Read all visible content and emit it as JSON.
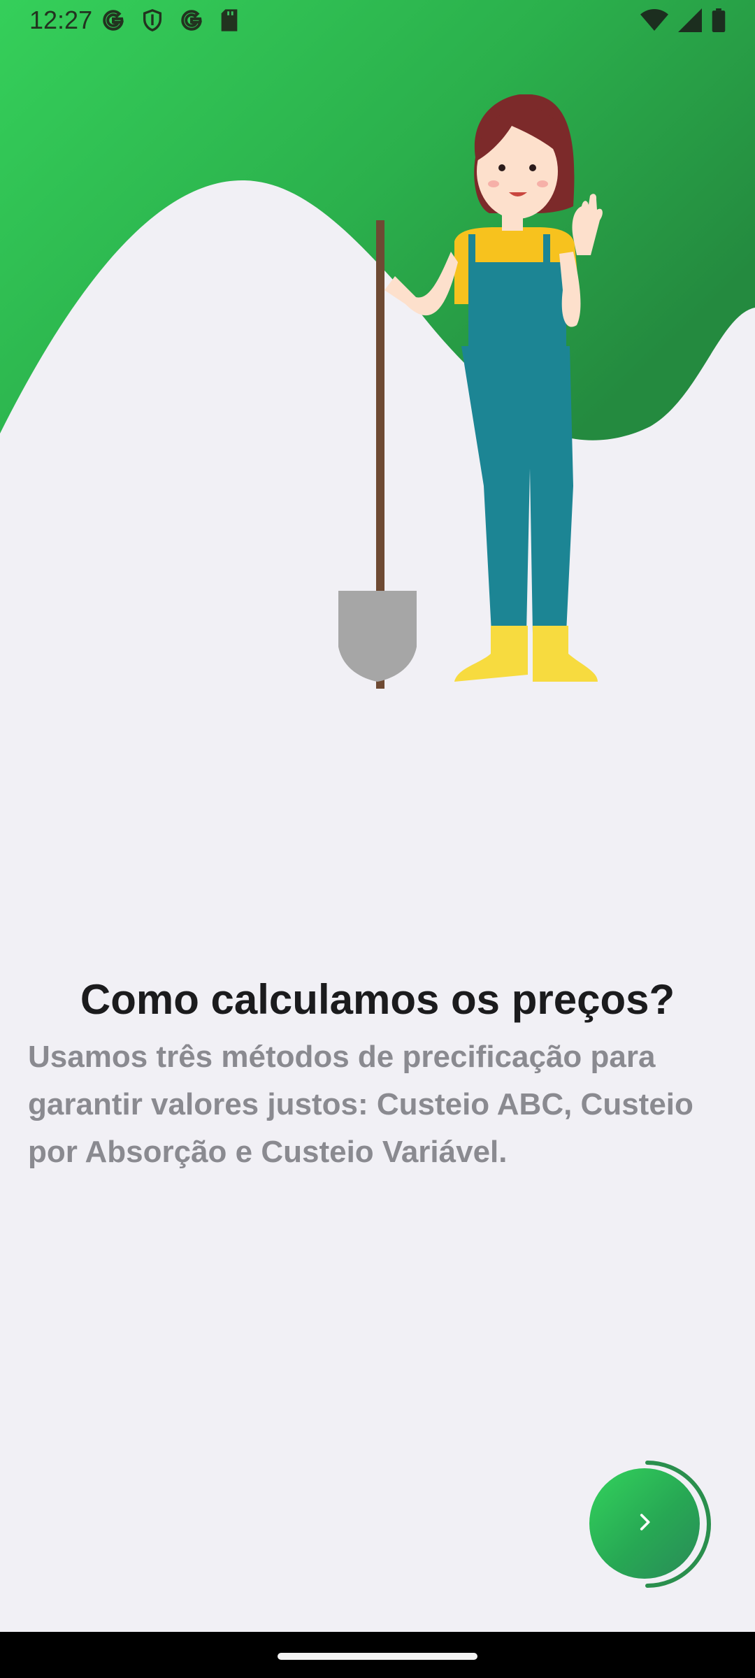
{
  "status_bar": {
    "time": "12:27",
    "left_icons": [
      "google-g-icon",
      "shield-icon",
      "google-g-icon",
      "sd-card-icon"
    ],
    "right_icons": [
      "wifi-icon",
      "signal-icon",
      "battery-icon"
    ]
  },
  "onboarding": {
    "title": "Como calculamos os preços?",
    "description": "Usamos três métodos de precificação para garantir valores justos: Custeio ABC, Custeio por Absorção e Custeio Variável."
  },
  "next_button": {
    "icon": "chevron-right-icon"
  },
  "colors": {
    "accent_green": "#2ecc5a",
    "dark_green": "#248a3f",
    "background": "#f1f0f5",
    "title_text": "#1b1b1d",
    "body_text": "#8a8a90"
  }
}
